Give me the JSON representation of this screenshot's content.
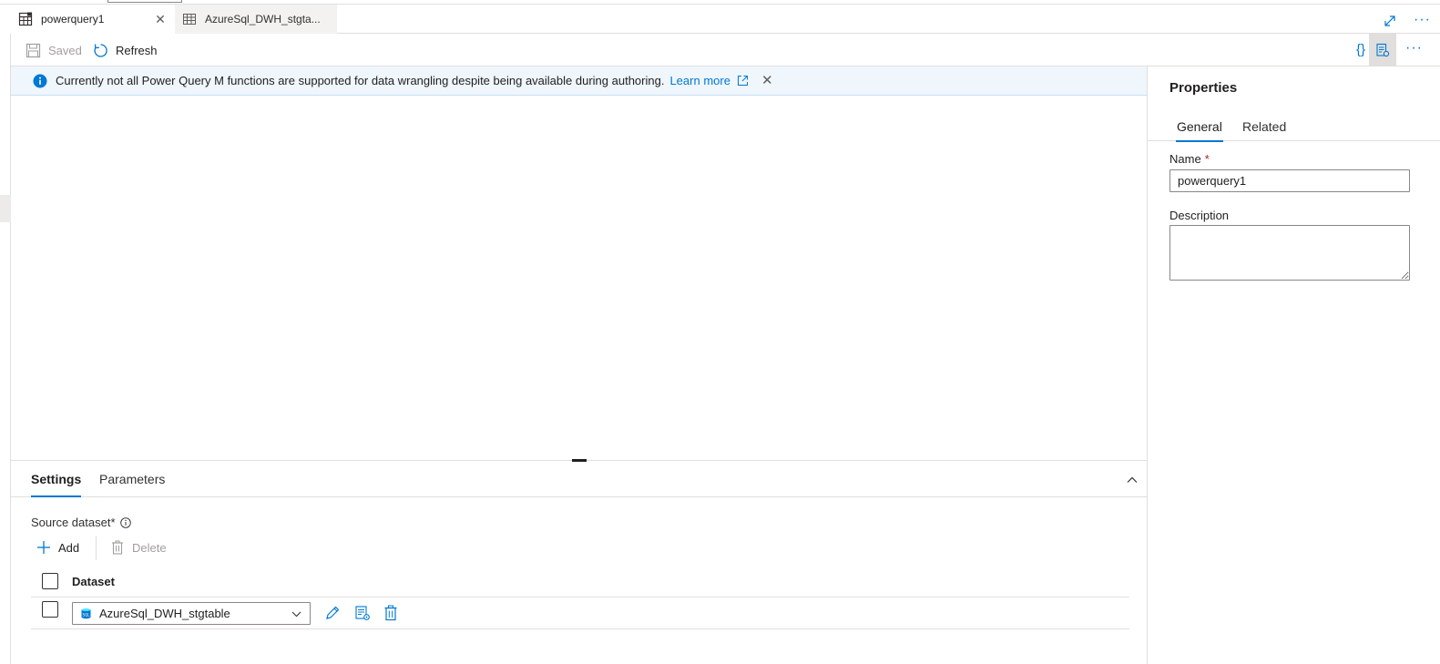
{
  "tabs": [
    {
      "label": "powerquery1",
      "icon": "powerquery-icon",
      "close": "✕"
    },
    {
      "label": "AzureSql_DWH_stgta...",
      "icon": "table-icon"
    }
  ],
  "tabbar": {
    "more": "···"
  },
  "toolbar": {
    "saved_label": "Saved",
    "refresh_label": "Refresh",
    "code_label": "{}",
    "more": "···"
  },
  "banner": {
    "text": "Currently not all Power Query M functions are supported for data wrangling despite being available during authoring.",
    "link": "Learn more",
    "close": "✕"
  },
  "bottom_panel": {
    "tabs": [
      "Settings",
      "Parameters"
    ],
    "source_label": "Source dataset*",
    "add_label": "Add",
    "delete_label": "Delete",
    "column_header": "Dataset",
    "rows": [
      {
        "dataset": "AzureSql_DWH_stgtable"
      }
    ]
  },
  "properties": {
    "title": "Properties",
    "tabs": [
      "General",
      "Related"
    ],
    "name_label": "Name",
    "name_required": "*",
    "name_value": "powerquery1",
    "description_label": "Description",
    "description_value": ""
  },
  "colors": {
    "accent": "#0078d4",
    "banner_bg": "#eff6fc",
    "border": "#e1dfdd",
    "disabled_text": "#a19f9d"
  }
}
